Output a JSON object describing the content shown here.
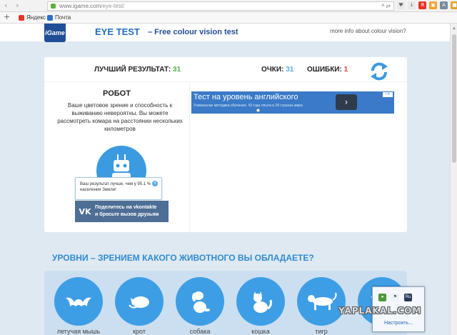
{
  "browser": {
    "nav_back": "‹",
    "nav_forward": "›",
    "url_host": "www.igame.com",
    "url_path": "/eye-test/",
    "url_icons": "ᴬ ⇄",
    "bookmarks_add": "+",
    "bookmarks": [
      {
        "label": "Яндекс",
        "icon": "yandex-icon",
        "color": "#e8322a"
      },
      {
        "label": "Почта",
        "icon": "mail-icon",
        "color": "#2b70c8"
      }
    ]
  },
  "site": {
    "logo": "iGame",
    "title": "EYE TEST",
    "subtitle": "– Free colour vision test",
    "more_info": "more info about colour vision?"
  },
  "score": {
    "best_label": "ЛУЧШИЙ РЕЗУЛЬТАТ:",
    "best_value": "31",
    "points_label": "ОЧКИ:",
    "points_value": "31",
    "errors_label": "ОШИБКИ:",
    "errors_value": "1"
  },
  "result": {
    "title": "РОБОТ",
    "description": "Ваше цветовое зрение и способность к выживанию невероятны. Вы можете рассмотреть комара на расстоянии нескольких километров",
    "tooltip": "Ваш результат лучше, чем у 95.1 % населения Земли!",
    "share_line1": "Поделитесь на vkontakte",
    "share_line2": "и бросьте вызов друзьям",
    "vk_logo": "VK"
  },
  "ad": {
    "title": "Тест на уровень английского",
    "text": "Уникальная методика обучения. 43 года опыта в 28 странах мира",
    "arrow": "›",
    "badge": "i ✕"
  },
  "levels": {
    "title": "УРОВНИ – ЗРЕНИЕМ КАКОГО ЖИВОТНОГО ВЫ ОБЛАДАЕТЕ?",
    "animals": [
      {
        "label": "летучая мышь",
        "icon": "bat-icon"
      },
      {
        "label": "крот",
        "icon": "mole-icon"
      },
      {
        "label": "собака",
        "icon": "dog-icon"
      },
      {
        "label": "кошка",
        "icon": "cat-icon"
      },
      {
        "label": "тигр",
        "icon": "tiger-icon"
      }
    ]
  },
  "tray": {
    "settings_link": "Настроить..."
  },
  "watermark": "YAPLAKAL.COM",
  "colors": {
    "accent": "#3e9ee5",
    "best_number": "#4fb34a",
    "error_number": "#e23a3a",
    "vk": "#4e6f95"
  }
}
